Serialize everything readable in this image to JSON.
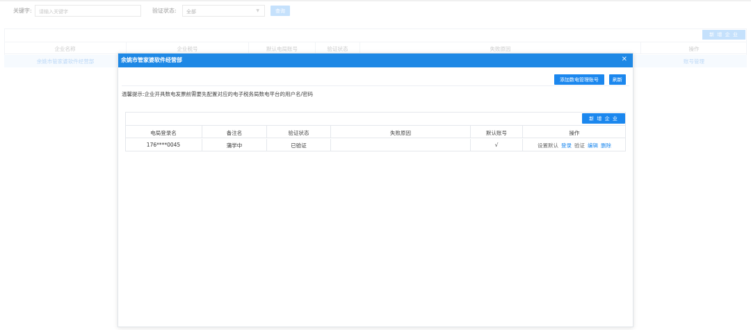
{
  "filter": {
    "keyword_label": "关键字:",
    "keyword_placeholder": "请输入关键字",
    "status_label": "验证状态:",
    "status_value": "全部",
    "query_button": "查询"
  },
  "bg_table": {
    "add_button": "新 增 企 业",
    "headers": [
      "企业名称",
      "企业税号",
      "默认电局账号",
      "验证状态",
      "失败原因",
      "操作"
    ],
    "row": {
      "name": "余姚市管家婆软件经营部",
      "action": "账号管理"
    }
  },
  "modal": {
    "title": "余姚市管家婆软件经营部",
    "close_icon": "close-icon",
    "add_account_button": "添加数电管理账号",
    "refresh_button": "刷新",
    "tip": "温馨提示:企业开具数电发票前需要先配置对应的电子税务局数电平台的用户名/密码",
    "add_company_button": "新 增 企 业",
    "headers": [
      "电局登录名",
      "备注名",
      "验证状态",
      "失败原因",
      "默认账号",
      "操作"
    ],
    "rows": [
      {
        "login": "176****0045",
        "remark": "蒲学中",
        "status": "已验证",
        "reason": "",
        "default": "√",
        "ops": [
          "设置默认",
          "登录",
          "验证",
          "编辑",
          "删除"
        ]
      }
    ]
  },
  "colors": {
    "primary": "#1b87ee",
    "header": "#1e88e5",
    "light_primary": "#a7d1fb"
  }
}
